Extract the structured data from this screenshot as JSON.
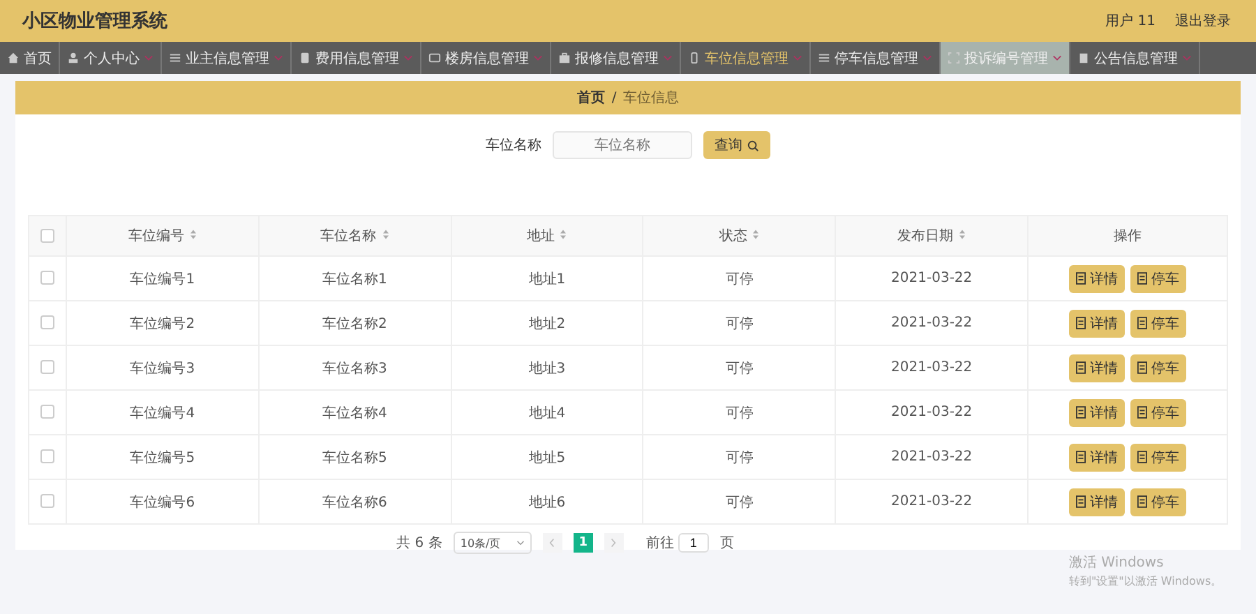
{
  "header": {
    "title": "小区物业管理系统",
    "user": "用户 11",
    "logout": "退出登录"
  },
  "nav": [
    {
      "label": "首页",
      "caret": false,
      "selected": false,
      "hovered": false
    },
    {
      "label": "个人中心",
      "caret": true,
      "selected": false,
      "hovered": false
    },
    {
      "label": "业主信息管理",
      "caret": true,
      "selected": false,
      "hovered": false
    },
    {
      "label": "费用信息管理",
      "caret": true,
      "selected": false,
      "hovered": false
    },
    {
      "label": "楼房信息管理",
      "caret": true,
      "selected": false,
      "hovered": false
    },
    {
      "label": "报修信息管理",
      "caret": true,
      "selected": false,
      "hovered": false
    },
    {
      "label": "车位信息管理",
      "caret": true,
      "selected": true,
      "hovered": false
    },
    {
      "label": "停车信息管理",
      "caret": true,
      "selected": false,
      "hovered": false
    },
    {
      "label": "投诉编号管理",
      "caret": true,
      "selected": false,
      "hovered": true
    },
    {
      "label": "公告信息管理",
      "caret": true,
      "selected": false,
      "hovered": false
    }
  ],
  "breadcrumb": {
    "separator": "/",
    "items": [
      {
        "label": "首页",
        "current": false
      },
      {
        "label": "车位信息",
        "current": true
      }
    ]
  },
  "search": {
    "label": "车位名称",
    "placeholder": "车位名称",
    "button": "查询"
  },
  "table": {
    "all_checked": false,
    "columns": [
      {
        "label": "车位编号",
        "sortable": true
      },
      {
        "label": "车位名称",
        "sortable": true
      },
      {
        "label": "地址",
        "sortable": true
      },
      {
        "label": "状态",
        "sortable": true
      },
      {
        "label": "发布日期",
        "sortable": true
      },
      {
        "label": "操作",
        "sortable": false
      }
    ],
    "rows": [
      {
        "checked": false,
        "cells": [
          "车位编号1",
          "车位名称1",
          "地址1",
          "可停",
          "2021-03-22"
        ],
        "actions": [
          "详情",
          "停车"
        ]
      },
      {
        "checked": false,
        "cells": [
          "车位编号2",
          "车位名称2",
          "地址2",
          "可停",
          "2021-03-22"
        ],
        "actions": [
          "详情",
          "停车"
        ]
      },
      {
        "checked": false,
        "cells": [
          "车位编号3",
          "车位名称3",
          "地址3",
          "可停",
          "2021-03-22"
        ],
        "actions": [
          "详情",
          "停车"
        ]
      },
      {
        "checked": false,
        "cells": [
          "车位编号4",
          "车位名称4",
          "地址4",
          "可停",
          "2021-03-22"
        ],
        "actions": [
          "详情",
          "停车"
        ]
      },
      {
        "checked": false,
        "cells": [
          "车位编号5",
          "车位名称5",
          "地址5",
          "可停",
          "2021-03-22"
        ],
        "actions": [
          "详情",
          "停车"
        ]
      },
      {
        "checked": false,
        "cells": [
          "车位编号6",
          "车位名称6",
          "地址6",
          "可停",
          "2021-03-22"
        ],
        "actions": [
          "详情",
          "停车"
        ]
      }
    ]
  },
  "pagination": {
    "total": "共 6 条",
    "page_size": "10条/页",
    "pages": [
      {
        "label": "1",
        "selected": true
      }
    ],
    "goto_label": "前往",
    "goto_value": "1",
    "goto_suffix": "页"
  },
  "os_notice": {
    "title": "激活 Windows",
    "text": "转到\"设置\"以激活 Windows。"
  }
}
